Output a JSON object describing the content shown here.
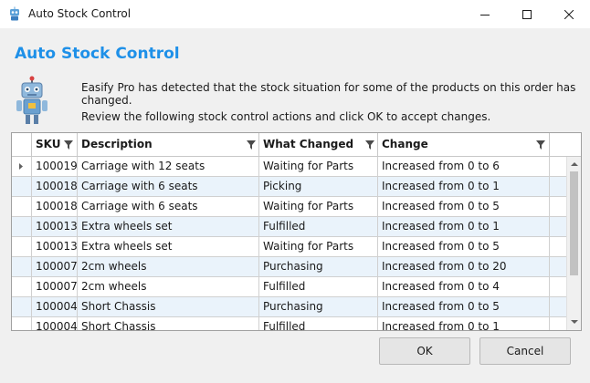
{
  "window": {
    "title": "Auto Stock Control",
    "icon": "robot-icon"
  },
  "heading": "Auto Stock Control",
  "message": {
    "line1": "Easify Pro has detected that the stock situation for some of the products on this order has changed.",
    "line2": "Review the following stock control actions and click OK to accept changes."
  },
  "table": {
    "columns": {
      "sku": "SKU",
      "description": "Description",
      "what_changed": "What Changed",
      "change": "Change"
    },
    "rows": [
      {
        "sku": "100019",
        "description": "Carriage with 12 seats",
        "what_changed": "Waiting for Parts",
        "change": "Increased from 0 to 6"
      },
      {
        "sku": "100018",
        "description": "Carriage with 6 seats",
        "what_changed": "Picking",
        "change": "Increased from 0 to 1"
      },
      {
        "sku": "100018",
        "description": "Carriage with 6 seats",
        "what_changed": "Waiting for Parts",
        "change": "Increased from 0 to 5"
      },
      {
        "sku": "100013",
        "description": "Extra wheels set",
        "what_changed": "Fulfilled",
        "change": "Increased from 0 to 1"
      },
      {
        "sku": "100013",
        "description": "Extra wheels set",
        "what_changed": "Waiting for Parts",
        "change": "Increased from 0 to 5"
      },
      {
        "sku": "100007",
        "description": "2cm wheels",
        "what_changed": "Purchasing",
        "change": "Increased from 0 to 20"
      },
      {
        "sku": "100007",
        "description": "2cm wheels",
        "what_changed": "Fulfilled",
        "change": "Increased from 0 to 4"
      },
      {
        "sku": "100004",
        "description": "Short Chassis",
        "what_changed": "Purchasing",
        "change": "Increased from 0 to 5"
      },
      {
        "sku": "100004",
        "description": "Short Chassis",
        "what_changed": "Fulfilled",
        "change": "Increased from 0 to 1"
      }
    ]
  },
  "buttons": {
    "ok": "OK",
    "cancel": "Cancel"
  },
  "colors": {
    "heading": "#1e90e8",
    "alt_row": "#eaf3fb"
  }
}
